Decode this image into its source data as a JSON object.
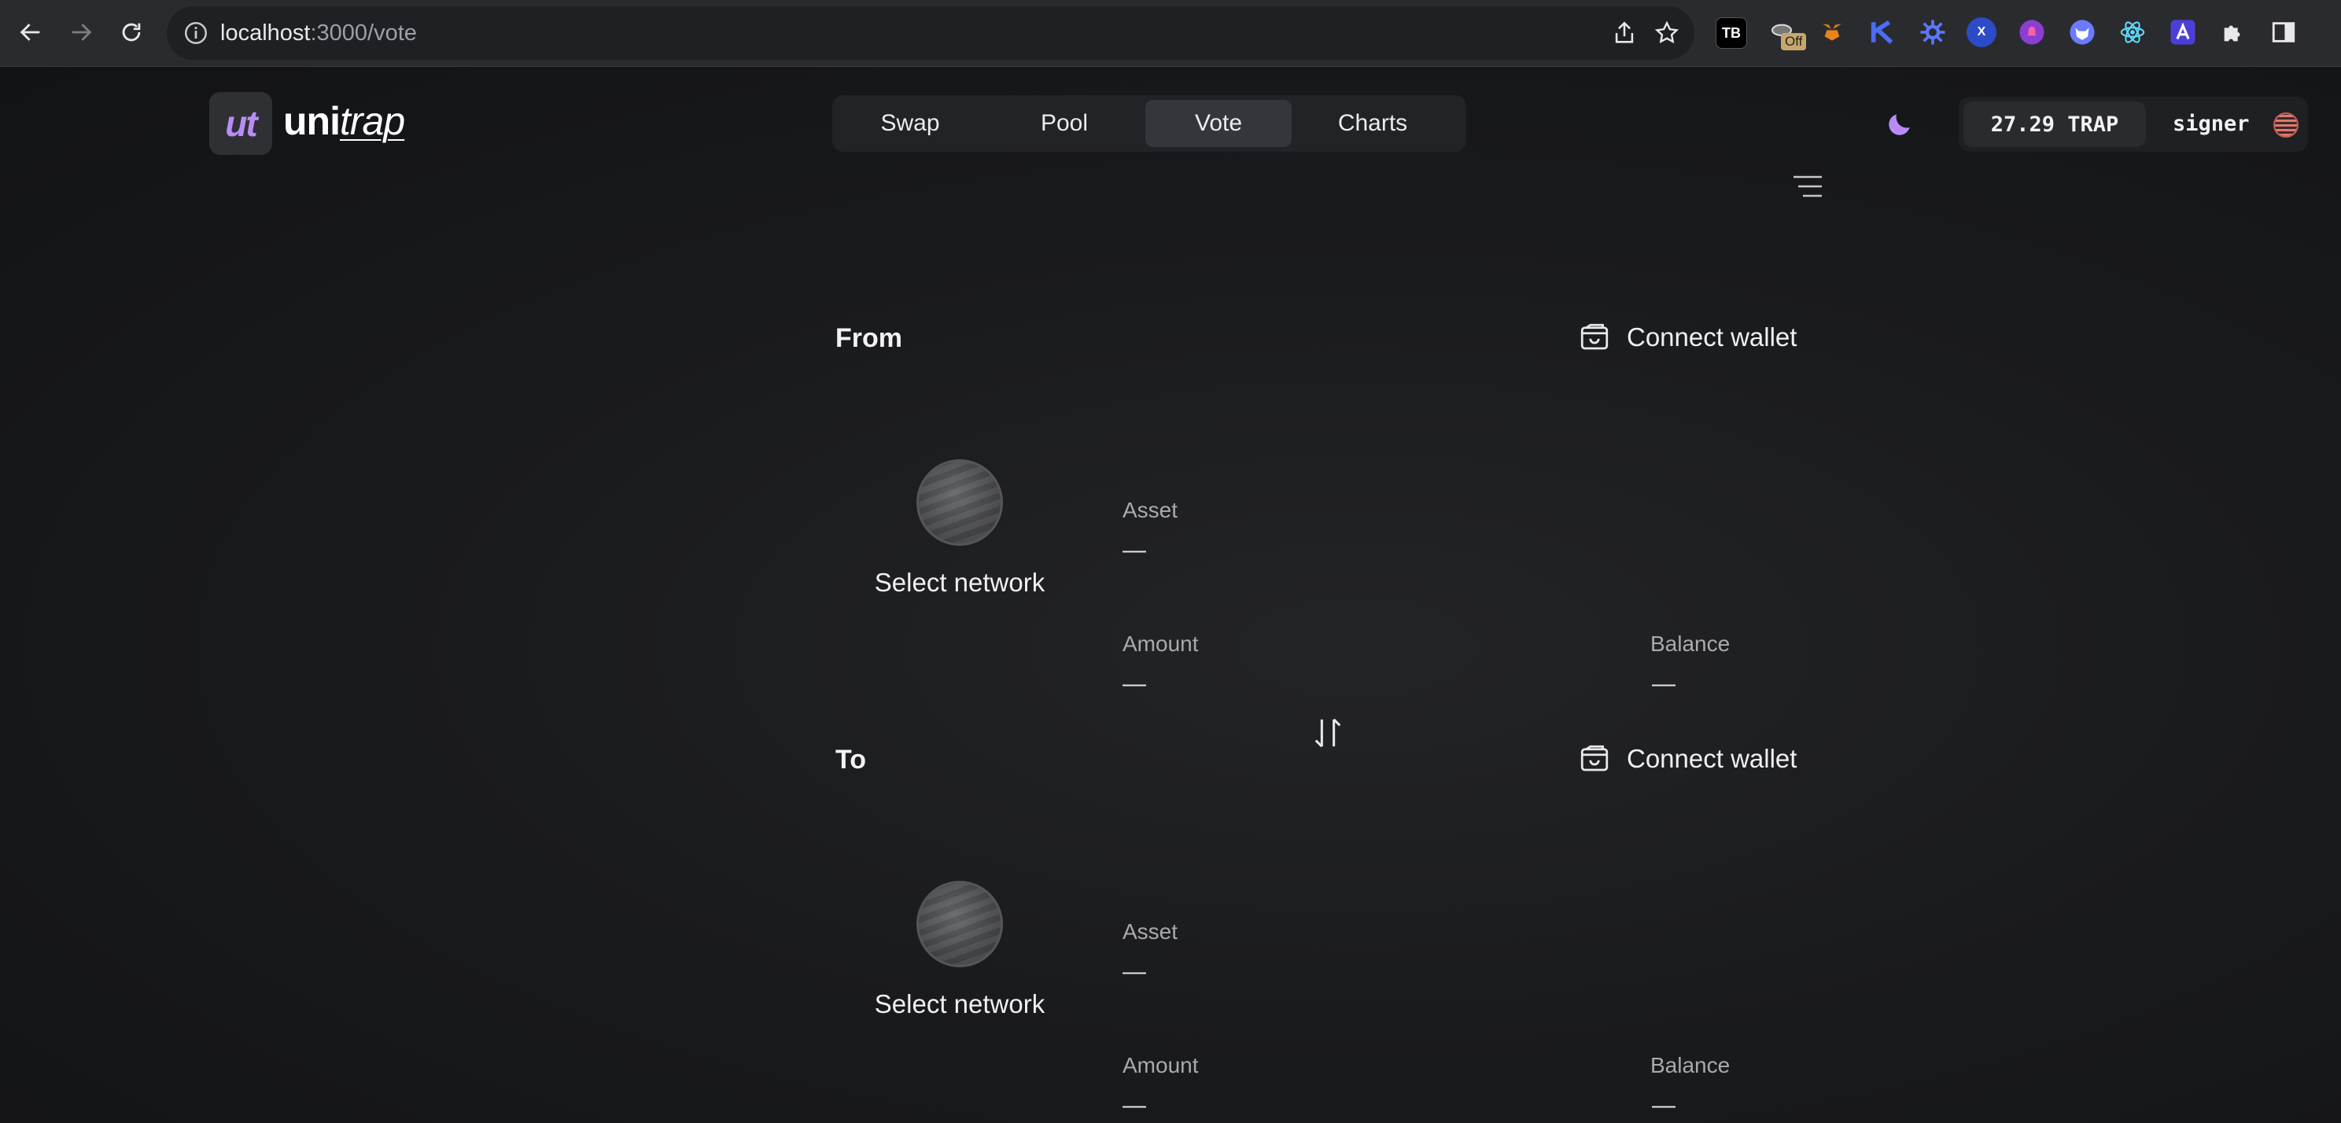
{
  "browser": {
    "url_host": "localhost",
    "url_path": ":3000/vote",
    "extensions": [
      "TB",
      "Off",
      "metamask-icon",
      "k-icon",
      "gear-icon",
      "x-icon",
      "bell-icon",
      "fox-icon",
      "react-icon",
      "a-icon",
      "puzzle-icon",
      "sidebar-icon"
    ],
    "ext_tb": "TB",
    "ext_x": "X",
    "ext_off": "Off"
  },
  "header": {
    "logo_mark": "ut",
    "logo_text_bold": "uni",
    "logo_text_italic": "trap",
    "tabs": [
      {
        "label": "Swap"
      },
      {
        "label": "Pool"
      },
      {
        "label": "Vote"
      },
      {
        "label": "Charts"
      }
    ],
    "active_tab": "Vote",
    "balance": "27.29 TRAP",
    "account": "signer"
  },
  "from": {
    "title": "From",
    "connect_label": "Connect wallet",
    "network_label": "Select network",
    "asset_label": "Asset",
    "asset_value": "—",
    "amount_label": "Amount",
    "amount_value": "—",
    "balance_label": "Balance",
    "balance_value": "—"
  },
  "to": {
    "title": "To",
    "connect_label": "Connect wallet",
    "network_label": "Select network",
    "asset_label": "Asset",
    "asset_value": "—",
    "amount_label": "Amount",
    "amount_value": "—",
    "balance_label": "Balance",
    "balance_value": "—"
  },
  "colors": {
    "accent": "#b98cf5",
    "background": "#16171a",
    "active_tab": "#34363b"
  }
}
